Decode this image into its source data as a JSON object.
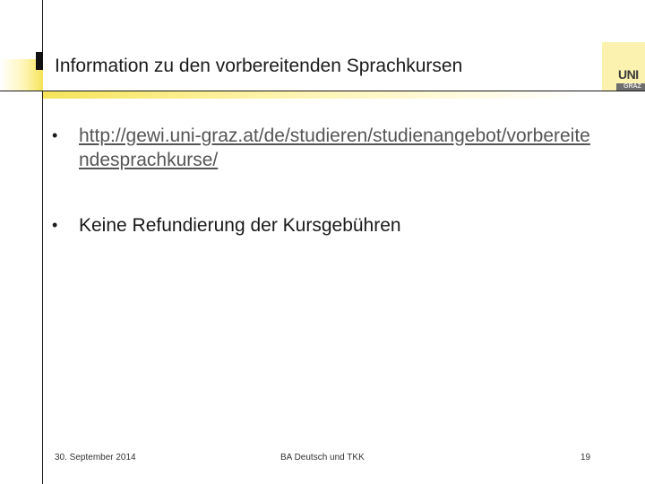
{
  "slide": {
    "title": "Information zu den vorbereitenden Sprachkursen",
    "bullets": [
      {
        "text": "http://gewi.uni-graz.at/de/studieren/studienangebot/vorbereitendesprachkurse/",
        "is_link": true
      },
      {
        "text": "Keine Refundierung der Kursgebühren",
        "is_link": false
      }
    ],
    "bullet_glyph": "•"
  },
  "footer": {
    "date": "30. September 2014",
    "center": "BA Deutsch und TKK",
    "page": "19"
  },
  "logo": {
    "text_top": "UNI",
    "text_bottom": "GRAZ"
  },
  "colors": {
    "accent_yellow": "#f5e45a",
    "link_gray": "#555555",
    "text": "#1a1a1a"
  }
}
